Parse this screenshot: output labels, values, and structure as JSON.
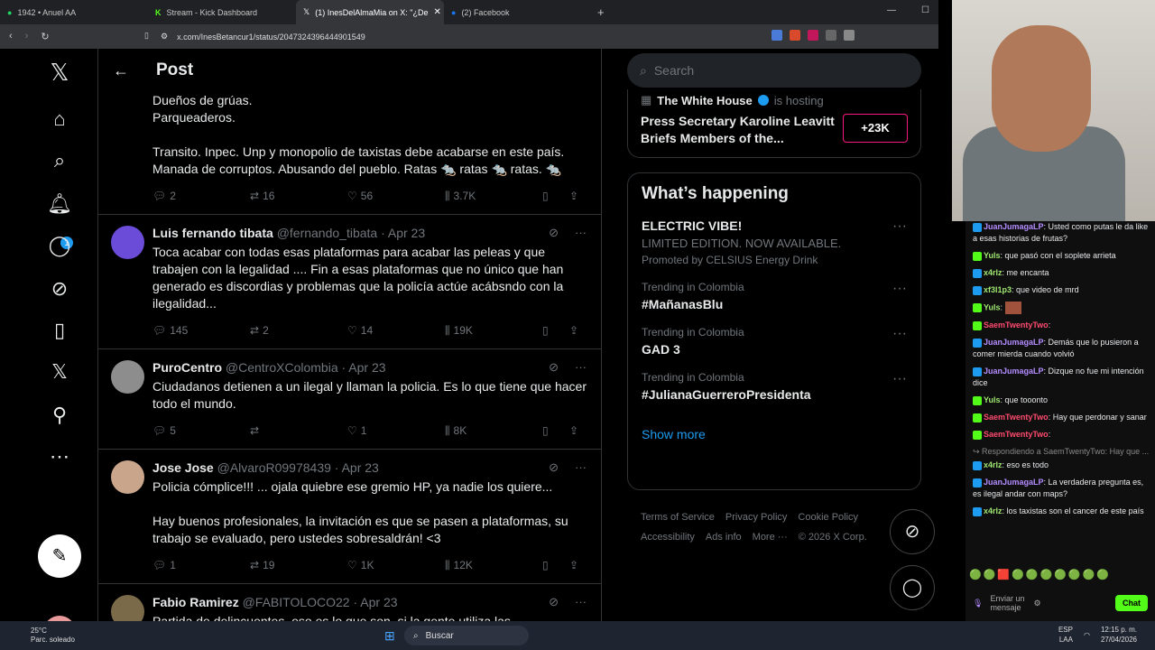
{
  "browser": {
    "tabs": [
      {
        "label": "1942 • Anuel AA",
        "icon": "spotify-icon",
        "active": false
      },
      {
        "label": "Stream - Kick Dashboard",
        "icon": "kick-icon",
        "active": false
      },
      {
        "label": "(1) InesDelAlmaMia on X: \"¿De",
        "icon": "x-logo-icon",
        "active": true
      },
      {
        "label": "(2) Facebook",
        "icon": "facebook-icon",
        "active": false
      }
    ],
    "url": "x.com/InesBetancur1/status/2047324396444901549"
  },
  "sidebar": {
    "notifications_badge": "1"
  },
  "main": {
    "header_title": "Post",
    "first_post": {
      "lines": [
        "Dueños de grúas.",
        "Parqueaderos.",
        "",
        "Transito.  Inpec. Unp y monopolio de taxistas debe acabarse en este país. Manada de corruptos.  Abusando del pueblo.  Ratas 🐀 ratas 🐀 ratas. 🐀"
      ],
      "replies": "2",
      "reposts": "16",
      "likes": "56",
      "views": "3.7K"
    },
    "replies": [
      {
        "name": "Luis fernando tibata",
        "handle": "@fernando_tibata",
        "date": "· Apr 23",
        "text": "Toca acabar con todas esas plataformas para acabar las peleas y que trabajen con la legalidad .... Fin a esas plataformas que no único que han generado es discordias y problemas que la policía actúe acábsndo con la ilegalidad...",
        "replies": "145",
        "reposts": "2",
        "likes": "14",
        "views": "19K",
        "avatar": "#6a4cd8"
      },
      {
        "name": "PuroCentro",
        "handle": "@CentroXColombia",
        "date": "· Apr 23",
        "text": "Ciudadanos detienen a un ilegal y llaman la policia. Es lo que tiene que hacer todo el mundo.",
        "replies": "5",
        "reposts": "",
        "likes": "1",
        "views": "8K",
        "avatar": "#8d8d8d"
      },
      {
        "name": "Jose Jose",
        "handle": "@AlvaroR09978439",
        "date": "· Apr 23",
        "text": "Policia cómplice!!! ... ojala quiebre ese gremio HP, ya nadie los quiere...\n\nHay buenos profesionales, la invitación es que se pasen a plataformas, su trabajo se evaluado, pero ustedes sobresaldrán! <3",
        "replies": "1",
        "reposts": "19",
        "likes": "1K",
        "views": "12K",
        "avatar": "#c9a58b"
      },
      {
        "name": "Fabio Ramirez",
        "handle": "@FABITOLOCO22",
        "date": "· Apr 23",
        "text": "Partida de delincuentes, eso es lo que son, si la gente utiliza las",
        "replies": "",
        "reposts": "",
        "likes": "",
        "views": "",
        "avatar": "#7a6a4a"
      }
    ]
  },
  "right": {
    "search_placeholder": "Search",
    "live": {
      "host": "The White House",
      "hosting": "is hosting",
      "title": "Press Secretary Karoline Leavitt Briefs Members of the...",
      "count": "+23K"
    },
    "happening_title": "What’s happening",
    "trends": [
      {
        "sub": "",
        "name": "ELECTRIC VIBE!",
        "extra": "LIMITED EDITION. NOW AVAILABLE.",
        "promo": "Promoted by CELSIUS Energy Drink"
      },
      {
        "sub": "Trending in Colombia",
        "name": "#MañanasBlu"
      },
      {
        "sub": "Trending in Colombia",
        "name": "GAD 3"
      },
      {
        "sub": "Trending in Colombia",
        "name": "#JulianaGuerreroPresidenta"
      }
    ],
    "show_more": "Show more",
    "footer": [
      "Terms of Service",
      "Privacy Policy",
      "Cookie Policy",
      "Accessibility",
      "Ads info",
      "More ···",
      "© 2026 X Corp."
    ]
  },
  "chat": {
    "messages": [
      {
        "user": "JuanJumagaLP",
        "color": "#b38cff",
        "text": ": Usted como putas le da like a esas historias de frutas?"
      },
      {
        "user": "Yuls",
        "color": "#9fe870",
        "text": ": que pasó con el soplete arrieta"
      },
      {
        "user": "x4rlz",
        "color": "#9fe870",
        "text": ": me encanta"
      },
      {
        "user": "xf3l1p3",
        "color": "#9fe870",
        "text": ": que video de mrd"
      },
      {
        "user": "Yuls",
        "color": "#9fe870",
        "text": ":"
      },
      {
        "user": "SaemTwentyTwo",
        "color": "#ff4b6e",
        "text": ": "
      },
      {
        "user": "JuanJumagaLP",
        "color": "#b38cff",
        "text": ": Demás que lo pusieron a comer mierda cuando volvió"
      },
      {
        "user": "JuanJumagaLP",
        "color": "#b38cff",
        "text": ": Dizque no fue mi intención dice"
      },
      {
        "user": "Yuls",
        "color": "#9fe870",
        "text": ": que tooonto"
      },
      {
        "user": "SaemTwentyTwo",
        "color": "#ff4b6e",
        "text": ": Hay que perdonar y sanar"
      },
      {
        "user": "SaemTwentyTwo",
        "color": "#ff4b6e",
        "text": ": "
      },
      {
        "user": "x4rlz",
        "color": "#9fe870",
        "text": ": eso es todo"
      },
      {
        "user": "JuanJumagaLP",
        "color": "#b38cff",
        "text": ": La verdadera pregunta es, es ilegal andar con maps?"
      },
      {
        "user": "x4rlz",
        "color": "#9fe870",
        "text": ": los taxistas son el cancer de este país"
      }
    ],
    "reply_note": "↪ Respondiendo a SaemTwentyTwo: Hay que ...",
    "input_placeholder": "Enviar un mensaje",
    "send_label": "Chat"
  },
  "taskbar": {
    "temp": "25°C",
    "weather": "Parc. soleado",
    "search": "Buscar",
    "lang1": "ESP",
    "lang2": "LAA",
    "time": "12:15 p. m.",
    "date": "27/04/2026"
  }
}
